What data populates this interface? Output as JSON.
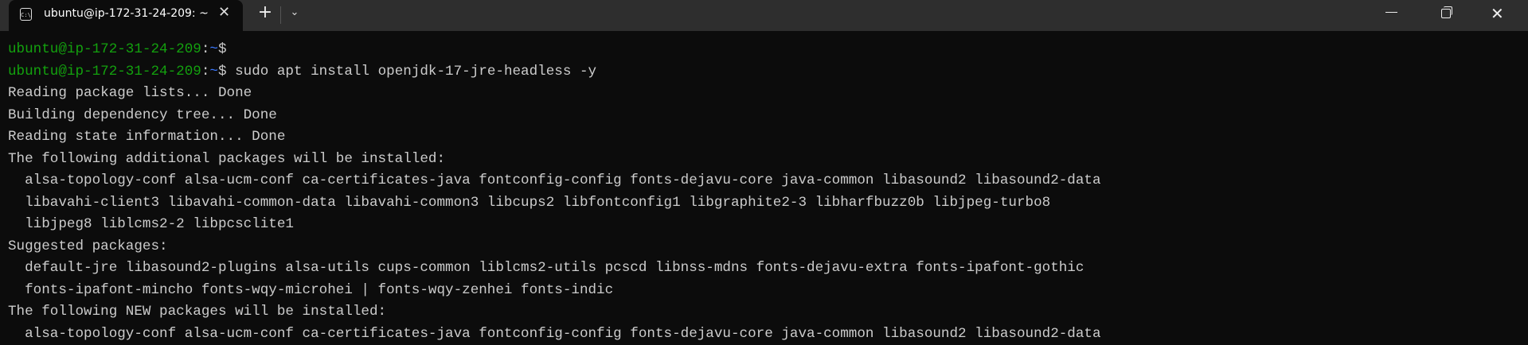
{
  "window": {
    "tab_title": "ubuntu@ip-172-31-24-209: ~",
    "tab_icon": "terminal-icon",
    "new_tab": "+",
    "dropdown": "⌄",
    "close_tab": "✕",
    "close": "✕"
  },
  "colors": {
    "prompt_user": "#13a10e",
    "prompt_path": "#3b78ff",
    "text": "#cccccc",
    "background": "#0c0c0c"
  },
  "terminal": {
    "prompts": [
      {
        "user": "ubuntu@ip-172-31-24-209",
        "sep": ":",
        "path": "~",
        "sym": "$",
        "cmd": ""
      },
      {
        "user": "ubuntu@ip-172-31-24-209",
        "sep": ":",
        "path": "~",
        "sym": "$",
        "cmd": " sudo apt install openjdk-17-jre-headless -y"
      }
    ],
    "output": [
      "Reading package lists... Done",
      "Building dependency tree... Done",
      "Reading state information... Done",
      "The following additional packages will be installed:",
      "  alsa-topology-conf alsa-ucm-conf ca-certificates-java fontconfig-config fonts-dejavu-core java-common libasound2 libasound2-data",
      "  libavahi-client3 libavahi-common-data libavahi-common3 libcups2 libfontconfig1 libgraphite2-3 libharfbuzz0b libjpeg-turbo8",
      "  libjpeg8 liblcms2-2 libpcsclite1",
      "Suggested packages:",
      "  default-jre libasound2-plugins alsa-utils cups-common liblcms2-utils pcscd libnss-mdns fonts-dejavu-extra fonts-ipafont-gothic",
      "  fonts-ipafont-mincho fonts-wqy-microhei | fonts-wqy-zenhei fonts-indic",
      "The following NEW packages will be installed:",
      "  alsa-topology-conf alsa-ucm-conf ca-certificates-java fontconfig-config fonts-dejavu-core java-common libasound2 libasound2-data"
    ]
  }
}
